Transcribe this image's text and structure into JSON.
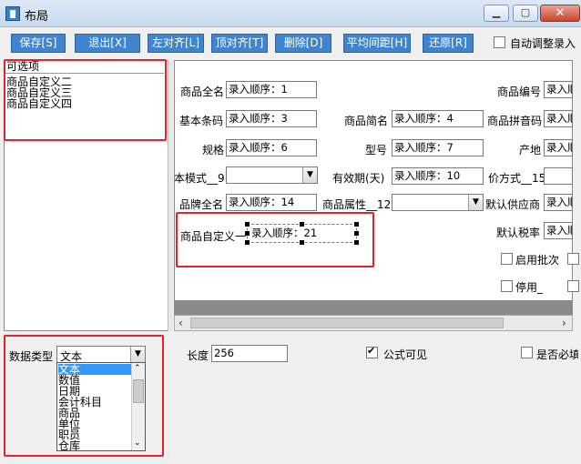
{
  "window": {
    "title": "布局",
    "min": "▁",
    "max": "▢",
    "close": "✕"
  },
  "toolbar": {
    "buttons": [
      "保存[S]",
      "退出[X]",
      "左对齐[L]",
      "顶对齐[T]",
      "删除[D]",
      "平均间距[H]",
      "还原[R]"
    ],
    "auto_adjust_label": "自动调整录入"
  },
  "left_panel": {
    "header": "可选项",
    "items": [
      "商品自定义二",
      "商品自定义三",
      "商品自定义四"
    ]
  },
  "canvas": {
    "fields": [
      {
        "label": "商品全名",
        "value": "录入顺序：1"
      },
      {
        "label": "商品编号",
        "value": "录入顺"
      },
      {
        "label": "基本条码",
        "value": "录入顺序：3"
      },
      {
        "label": "商品简名",
        "value": "录入顺序：4"
      },
      {
        "label": "商品拼音码",
        "value": "录入顺"
      },
      {
        "label": "规格",
        "value": "录入顺序：6"
      },
      {
        "label": "型号",
        "value": "录入顺序：7"
      },
      {
        "label": "产地",
        "value": "录入顺"
      },
      {
        "label": "本模式__9",
        "value": ""
      },
      {
        "label": "有效期(天)",
        "value": "录入顺序：10"
      },
      {
        "label": "价方式__15",
        "value": ""
      },
      {
        "label": "品牌全名",
        "value": "录入顺序：14"
      },
      {
        "label": "商品属性__12",
        "value": ""
      },
      {
        "label": "默认供应商",
        "value": "录入顺"
      },
      {
        "label": "商品自定义一",
        "value": "录入顺序：21"
      },
      {
        "label": "默认税率",
        "value": "录入顺"
      }
    ],
    "checkboxes": [
      "启用批次",
      "停用_"
    ]
  },
  "bottom": {
    "data_type_label": "数据类型",
    "data_type_value": "文本",
    "data_type_options": [
      "文本",
      "数值",
      "日期",
      "会计科目",
      "商品",
      "单位",
      "职员",
      "仓库"
    ],
    "length_label": "长度",
    "length_value": "256",
    "formula_visible_label": "公式可见",
    "required_label": "是否必填"
  },
  "colors": {
    "toolbar_button": "#3f84cd",
    "highlight_box": "#e3242b",
    "selection": "#3399ff"
  }
}
